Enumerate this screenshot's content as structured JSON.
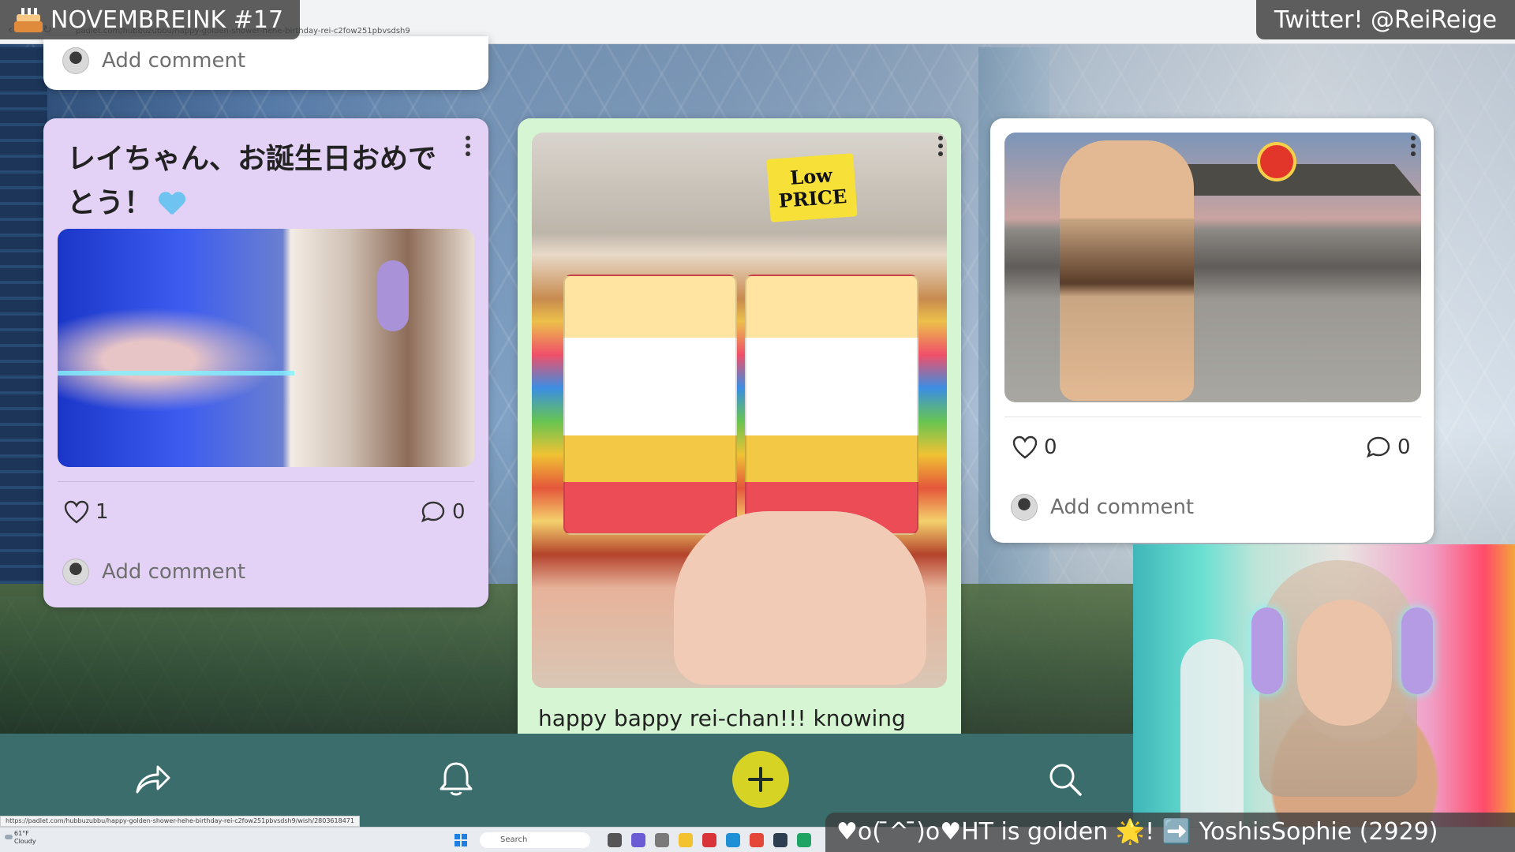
{
  "stream_overlay": {
    "title": "NOVEMBREINK #17",
    "twitter": "Twitter! @ReiReige",
    "chat_ticker": "♥o( ̄^ ̄)o♥HT is golden 🌟! ➡️ YoshisSophie (2929)"
  },
  "browser": {
    "url": "padlet.com/hubbuzubbu/happy-golden-shower-hehe-birthday-rei-c2fow251pbvsdsh9",
    "status_url": "https://padlet.com/hubbuzubbu/happy-golden-shower-hehe-birthday-rei-c2fow251pbvsdsh9/wish/2803618471"
  },
  "cards": {
    "top_left": {
      "add_comment": "Add comment"
    },
    "lilac": {
      "title": "レイちゃん、お誕生日おめでとう！",
      "likes": "1",
      "comments": "0",
      "add_comment": "Add comment",
      "color": "#e4d2f6"
    },
    "green": {
      "price_tag_line1": "Low",
      "price_tag_line2": "PRICE",
      "caption": "happy bappy rei-chan!!! knowing",
      "color": "#d6f5d2"
    },
    "white": {
      "likes": "0",
      "comments": "0",
      "add_comment": "Add comment",
      "color": "#ffffff"
    }
  },
  "toolbar": {
    "share_icon": "share-arrow-icon",
    "notifications_icon": "bell-icon",
    "add_icon": "plus-icon",
    "search_icon": "search-icon",
    "accent": "#d6d324",
    "background": "#3a6d6b"
  },
  "taskbar": {
    "search_placeholder": "Search",
    "weather_temp": "61°F",
    "weather_desc": "Cloudy"
  }
}
